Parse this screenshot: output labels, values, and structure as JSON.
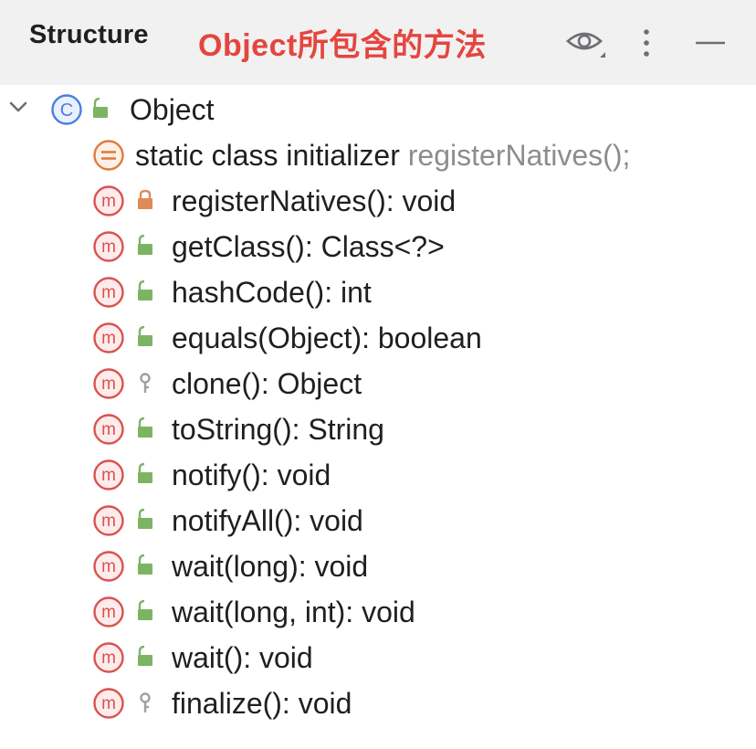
{
  "header": {
    "title": "Structure",
    "annotation": "Object所包含的方法",
    "actions": [
      "eye-icon",
      "more-vertical-icon",
      "minimize-icon"
    ]
  },
  "tree": {
    "root": {
      "label": "Object",
      "kind_icon": "class-icon",
      "access_icon": "public-icon",
      "expanded": true
    },
    "initializer": {
      "label": "static class initializer",
      "hint": "registerNatives();",
      "kind_icon": "static-initializer-icon"
    },
    "methods": [
      {
        "label": "registerNatives(): void",
        "access": "private"
      },
      {
        "label": "getClass(): Class<?>",
        "access": "public"
      },
      {
        "label": "hashCode(): int",
        "access": "public"
      },
      {
        "label": "equals(Object): boolean",
        "access": "public"
      },
      {
        "label": "clone(): Object",
        "access": "protected"
      },
      {
        "label": "toString(): String",
        "access": "public"
      },
      {
        "label": "notify(): void",
        "access": "public"
      },
      {
        "label": "notifyAll(): void",
        "access": "public"
      },
      {
        "label": "wait(long): void",
        "access": "public"
      },
      {
        "label": "wait(long, int): void",
        "access": "public"
      },
      {
        "label": "wait(): void",
        "access": "public"
      },
      {
        "label": "finalize(): void",
        "access": "protected"
      }
    ]
  },
  "colors": {
    "header_bg": "#f1f1f2",
    "annotation": "#e5453e",
    "method_icon": "#d9534f",
    "class_icon": "#4a7fe0",
    "initializer_icon": "#e27a3e",
    "public_lock": "#7db464",
    "private_lock": "#e08a5a",
    "protected_key": "#9aa0a6",
    "hint_text": "#8d8d8d"
  }
}
